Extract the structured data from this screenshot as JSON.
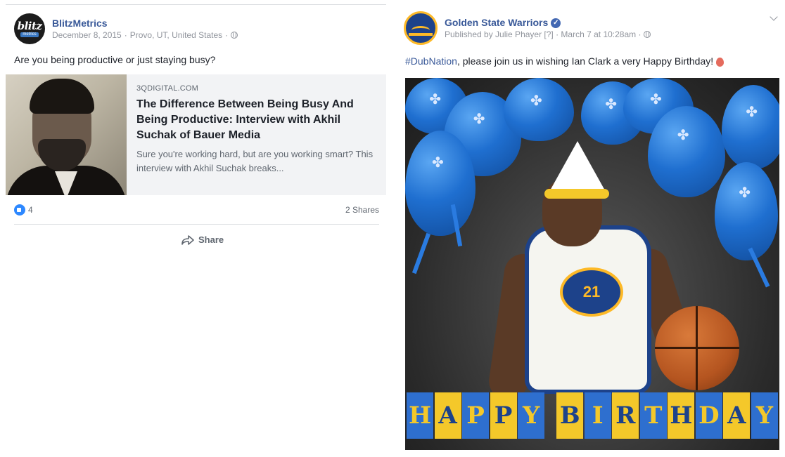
{
  "left_post": {
    "page_name": "BlitzMetrics",
    "avatar": {
      "line1": "blitz",
      "line2": "metrics"
    },
    "date": "December 8, 2015",
    "location": "Provo, UT, United States",
    "separator": "·",
    "text": "Are you being productive or just staying busy?",
    "link": {
      "domain": "3QDIGITAL.COM",
      "title": "The Difference Between Being Busy And Being Productive: Interview with Akhil Suchak of Bauer Media",
      "description": "Sure you're working hard, but are you working smart? This interview with Akhil Suchak breaks..."
    },
    "like_count": "4",
    "shares": "2 Shares",
    "share_label": "Share"
  },
  "right_post": {
    "page_name": "Golden State Warriors",
    "published_by": "Published by Julie Phayer [?] · March 7 at 10:28am ·",
    "hashtag": "#DubNation",
    "text": ", please join us in wishing Ian Clark a very Happy Birthday!",
    "jersey_number": "21",
    "banner_word1": [
      "H",
      "A",
      "P",
      "P",
      "Y"
    ],
    "banner_word2": [
      "B",
      "I",
      "R",
      "T",
      "H",
      "D",
      "A",
      "Y"
    ]
  },
  "colors": {
    "link_blue": "#385898",
    "meta_gray": "#90949c",
    "warriors_blue": "#1d428a",
    "warriors_gold": "#fdb927"
  }
}
